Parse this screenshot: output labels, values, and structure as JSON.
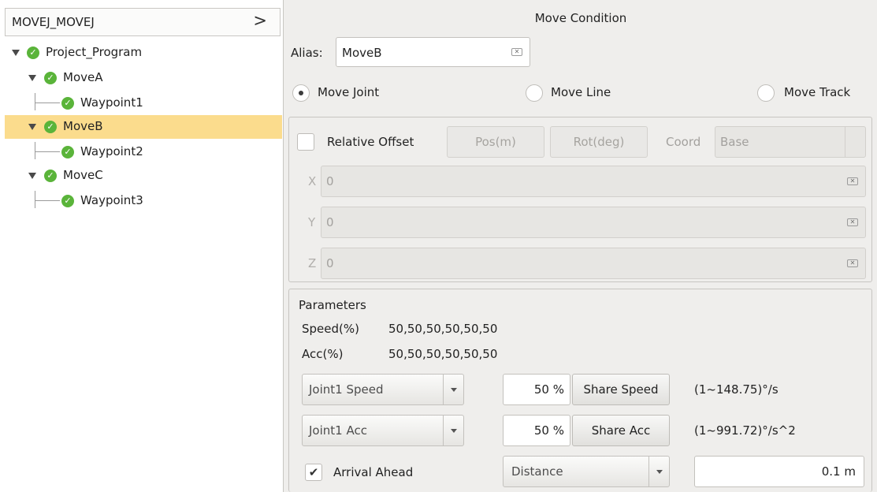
{
  "tree": {
    "header_title": "MOVEJ_MOVEJ",
    "header_chevron": ">",
    "items": [
      {
        "label": "Project_Program"
      },
      {
        "label": "MoveA"
      },
      {
        "label": "Waypoint1"
      },
      {
        "label": "MoveB"
      },
      {
        "label": "Waypoint2"
      },
      {
        "label": "MoveC"
      },
      {
        "label": "Waypoint3"
      }
    ],
    "selected_item": "MoveB",
    "check_glyph": "✓"
  },
  "header": {
    "title": "Move Condition"
  },
  "alias": {
    "label": "Alias:",
    "value": "MoveB",
    "clear_glyph": "✕"
  },
  "move_type": {
    "options": [
      {
        "label": "Move Joint"
      },
      {
        "label": "Move Line"
      },
      {
        "label": "Move Track"
      }
    ],
    "selected": "Move Joint"
  },
  "offset": {
    "checkbox_label": "Relative Offset",
    "checked": false,
    "pos_button": "Pos(m)",
    "rot_button": "Rot(deg)",
    "coord_label": "Coord",
    "coord_value": "Base",
    "fields": [
      {
        "label": "X",
        "value": "0"
      },
      {
        "label": "Y",
        "value": "0"
      },
      {
        "label": "Z",
        "value": "0"
      }
    ],
    "clear_glyph": "✕"
  },
  "parameters": {
    "title": "Parameters",
    "speed_label": "Speed(%)",
    "speed_value": "50,50,50,50,50,50",
    "acc_label": "Acc(%)",
    "acc_value": "50,50,50,50,50,50",
    "speed_combo": "Joint1 Speed",
    "speed_percent": "50 %",
    "share_speed_button": "Share Speed",
    "speed_range": "(1~148.75)°/s",
    "acc_combo": "Joint1 Acc",
    "acc_percent": "50 %",
    "share_acc_button": "Share Acc",
    "acc_range": "(1~991.72)°/s^2",
    "arrival_label": "Arrival Ahead",
    "arrival_checked": true,
    "arrival_check_glyph": "✔",
    "arrival_mode": "Distance",
    "arrival_value": "0.1 m"
  },
  "colors": {
    "selection": "#fbdc8d",
    "status_ok": "#5ab43a",
    "background": "#efeeec"
  }
}
